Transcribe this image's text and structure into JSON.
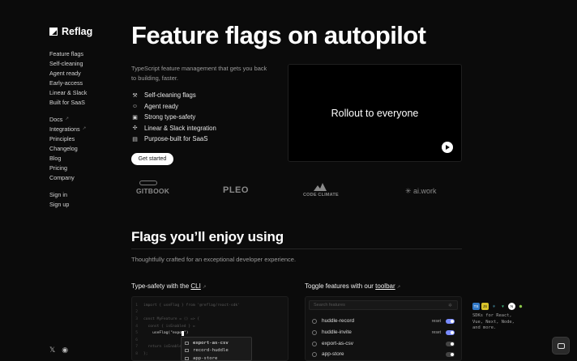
{
  "brand": {
    "name": "Reflag"
  },
  "sidebar": {
    "group1": [
      "Feature flags",
      "Self-cleaning",
      "Agent ready",
      "Early-access",
      "Linear & Slack",
      "Built for SaaS"
    ],
    "group2": [
      {
        "label": "Docs",
        "external": true
      },
      {
        "label": "Integrations",
        "external": true
      },
      {
        "label": "Principles"
      },
      {
        "label": "Changelog"
      },
      {
        "label": "Blog"
      },
      {
        "label": "Pricing"
      },
      {
        "label": "Company"
      }
    ],
    "group3": [
      "Sign in",
      "Sign up"
    ],
    "social_icons": [
      "x-icon",
      "github-icon"
    ]
  },
  "hero": {
    "title": "Feature flags on autopilot",
    "subtitle": "TypeScript feature management that gets you back to building, faster.",
    "features": [
      {
        "icon": "broom-icon",
        "label": "Self-cleaning flags"
      },
      {
        "icon": "robot-icon",
        "label": "Agent ready"
      },
      {
        "icon": "ts-icon",
        "label": "Strong type-safety"
      },
      {
        "icon": "slack-icon",
        "label": "Linear & Slack integration"
      },
      {
        "icon": "building-icon",
        "label": "Purpose-built for SaaS"
      }
    ],
    "cta_label": "Get started",
    "video_title": "Rollout to everyone"
  },
  "customer_logos": [
    "GITBOOK",
    "PLEO",
    "CODE CLIMATE",
    "ai.work"
  ],
  "section": {
    "title": "Flags you’ll enjoy using",
    "subtitle": "Thoughtfully crafted for an exceptional developer experience."
  },
  "typesafety": {
    "title_prefix": "Type-safety with the ",
    "title_link": "CLI",
    "code_lines": [
      "import { useFlag } from '@reflag/react-sdk'",
      "",
      "const MyFeature = () => {",
      "  const { isEnabled } =",
      "    useFlag(\"expo",
      "",
      "  return isEnabled ?",
      "};"
    ],
    "code_line_8_tail": ": null;",
    "autocomplete": [
      "export-as-csv",
      "record-huddle",
      "app-store"
    ]
  },
  "toolbar_demo": {
    "title_prefix": "Toggle features with our ",
    "title_link": "toolbar",
    "search_placeholder": "Search features",
    "flags": [
      {
        "name": "huddle-record",
        "reset": "reset",
        "enabled": true
      },
      {
        "name": "huddle-invite",
        "reset": "reset",
        "enabled": true
      },
      {
        "name": "export-as-csv",
        "reset": "",
        "enabled": false
      },
      {
        "name": "app-store",
        "reset": "",
        "enabled": false
      }
    ]
  },
  "sdks": {
    "icons": [
      "ts-icon",
      "js-icon",
      "react-icon",
      "vue-icon",
      "next-icon",
      "node-icon"
    ],
    "text": "SDKs for React, Vue, Next, Node, and more."
  },
  "colors": {
    "background": "#0b0b0b",
    "toggle_on": "#7a8cff"
  }
}
